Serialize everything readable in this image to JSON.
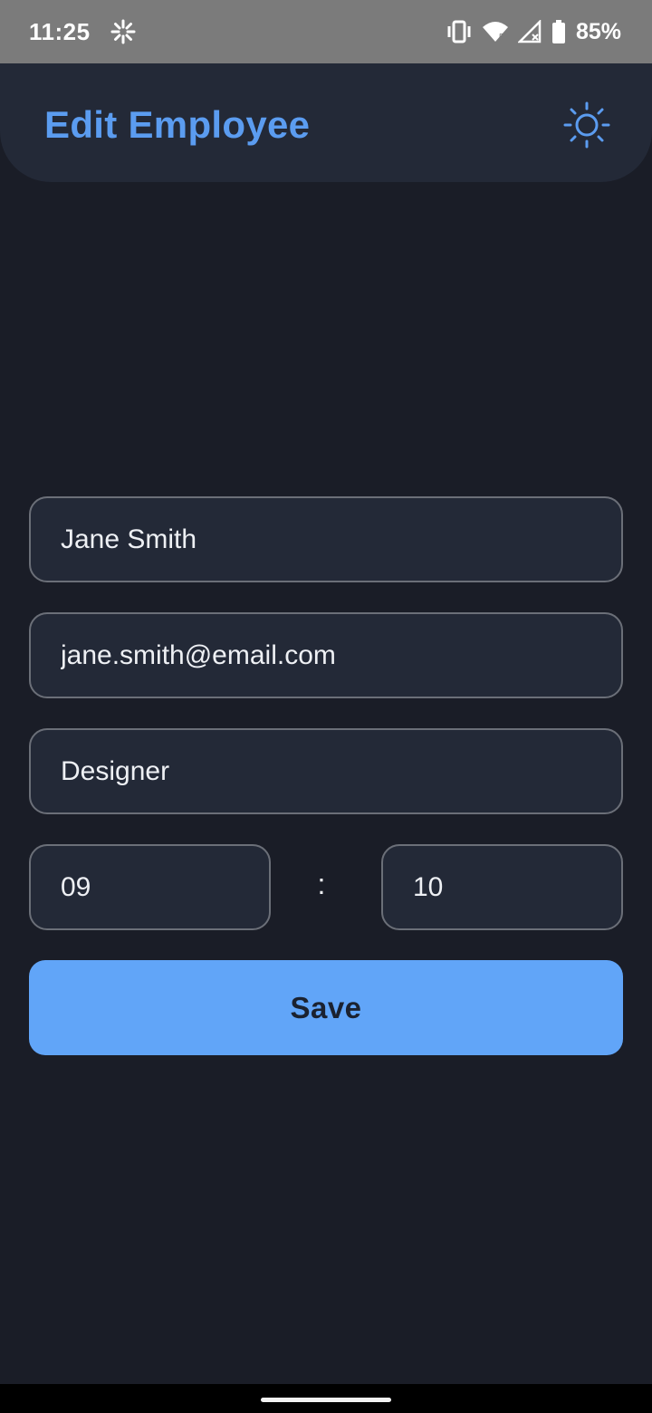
{
  "status_bar": {
    "time": "11:25",
    "battery_percent": "85%",
    "icons": [
      "loading-spinner-icon",
      "vibrate-icon",
      "wifi-icon",
      "signal-icon",
      "battery-icon"
    ]
  },
  "app_bar": {
    "title": "Edit Employee",
    "theme_toggle_icon": "sun-icon"
  },
  "form": {
    "name_value": "Jane Smith",
    "email_value": "jane.smith@email.com",
    "role_value": "Designer",
    "hour_value": "09",
    "separator": ":",
    "minute_value": "10",
    "save_label": "Save"
  },
  "colors": {
    "background": "#1a1d27",
    "surface": "#232937",
    "accent": "#5b9cf0",
    "button": "#61a5f8"
  }
}
